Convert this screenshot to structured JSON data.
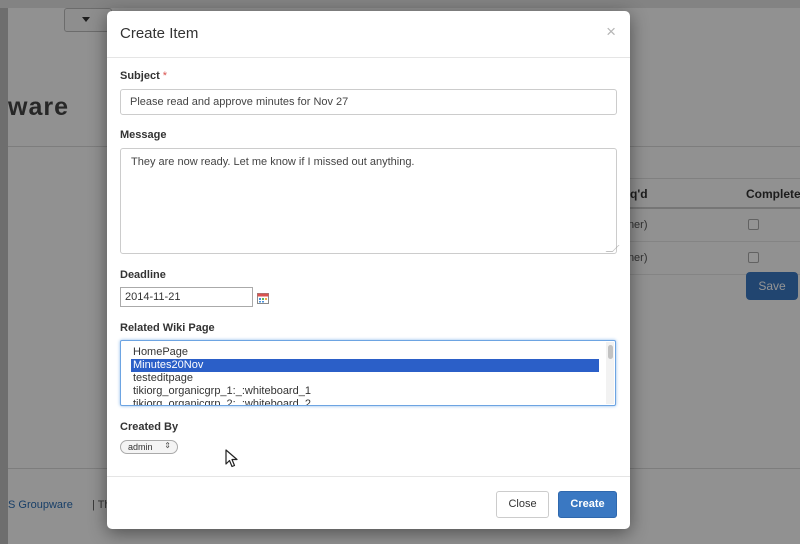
{
  "background": {
    "brand_text": "ware",
    "table": {
      "headers": [
        "leq'd",
        "Complete"
      ],
      "rows": [
        {
          "cell": "wner)"
        },
        {
          "cell": "wner)"
        }
      ]
    },
    "save_label": "Save",
    "footer_link": "S Groupware",
    "footer_rest": "| Th"
  },
  "modal": {
    "title": "Create Item",
    "close_symbol": "×",
    "subject": {
      "label": "Subject",
      "required_mark": "*",
      "value": "Please read and approve minutes for Nov 27"
    },
    "message": {
      "label": "Message",
      "value": "They are now ready. Let me know if I missed out anything."
    },
    "deadline": {
      "label": "Deadline",
      "value": "2014-11-21"
    },
    "related_wiki": {
      "label": "Related Wiki Page",
      "options": [
        "HomePage",
        "Minutes20Nov",
        "testeditpage",
        "tikiorg_organicgrp_1:_:whiteboard_1",
        "tikiorg_organicgrp_2:_:whiteboard_2"
      ],
      "selected_index": 1
    },
    "created_by": {
      "label": "Created By",
      "value": "admin",
      "arrow": "⇕"
    },
    "buttons": {
      "close": "Close",
      "create": "Create"
    }
  },
  "colors": {
    "primary": "#3a78c2",
    "selection": "#2b5fc8",
    "required": "#d9534f"
  }
}
